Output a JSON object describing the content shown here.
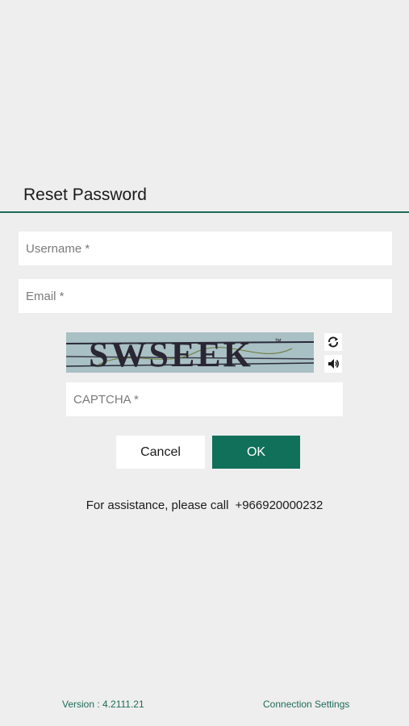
{
  "dialog": {
    "title": "Reset Password"
  },
  "form": {
    "username_placeholder": "Username *",
    "email_placeholder": "Email *",
    "captcha_placeholder": "CAPTCHA *",
    "captcha_text": "SWSEEK",
    "cancel_label": "Cancel",
    "ok_label": "OK"
  },
  "assistance": {
    "text": "For assistance, please call",
    "phone": "+966920000232"
  },
  "footer": {
    "version": "Version : 4.2111.21",
    "connection_settings": "Connection Settings"
  },
  "colors": {
    "accent": "#10705a",
    "divider": "#1f6b57",
    "background": "#eeeeee"
  },
  "icons": {
    "refresh": "refresh-icon",
    "audio": "speaker-icon"
  }
}
